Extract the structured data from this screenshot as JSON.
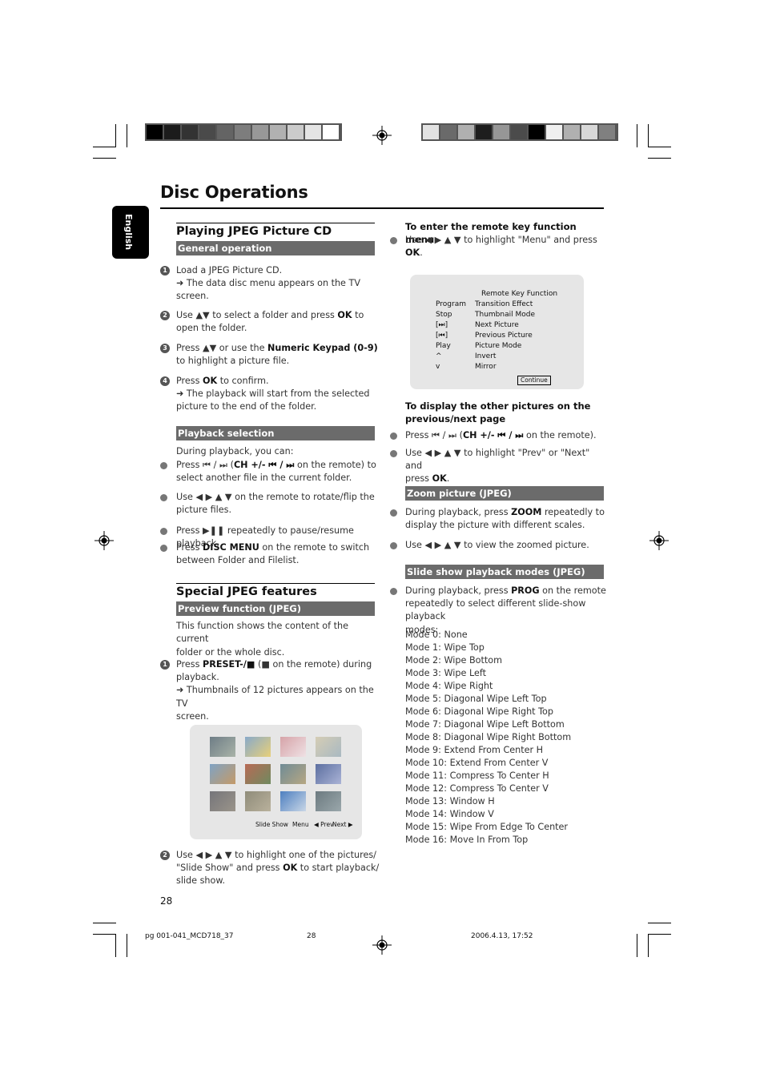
{
  "page": {
    "title": "Disc Operations",
    "language_tab": "English",
    "page_number": "28"
  },
  "print_marks": {
    "color_bar_left": [
      "#000000",
      "#1c1c1c",
      "#333333",
      "#4a4a4a",
      "#646464",
      "#7d7d7d",
      "#989898",
      "#b1b1b1",
      "#cbcbcb",
      "#e4e4e4",
      "#ffffff"
    ],
    "color_bar_right": [
      "#e2e2e2",
      "#6a6a6a",
      "#b0b0b0",
      "#1e1e1e",
      "#969696",
      "#4b4b4b",
      "#000000",
      "#f0f0f0",
      "#b0b0b0",
      "#d8d8d8",
      "#808080"
    ],
    "footer_file": "pg 001-041_MCD718_37",
    "footer_page": "28",
    "footer_date": "2006.4.13, 17:52"
  },
  "left": {
    "section1_title": "Playing JPEG Picture CD",
    "general_head": "General operation",
    "steps": [
      {
        "n": "1",
        "line1": "Load a JPEG Picture CD.",
        "line2": "➜ The data disc menu appears on the TV",
        "line3": "screen."
      },
      {
        "n": "2",
        "pre": "Use ▲▼  to select a folder and press ",
        "bold": "OK",
        "post": " to",
        "line2": "open the folder."
      },
      {
        "n": "3",
        "pre": "Press ▲▼  or use the ",
        "bold": "Numeric Keypad (0-9)",
        "line2": "to highlight a picture file."
      },
      {
        "n": "4",
        "pre": "Press ",
        "bold": "OK",
        "post": " to confirm.",
        "line2": "➜ The playback will start from the selected",
        "line3": "picture to the end of the folder."
      }
    ],
    "playback_head": "Playback selection",
    "playback_intro": "During playback, you can:",
    "playback_bullets": [
      {
        "pre": "Press  ⏮ / ⏭ (",
        "bold": "CH +/- ⏮ / ⏭",
        "post": " on the remote) to",
        "line2": "select another file in the current folder."
      },
      {
        "pre": "Use ◀ ▶ ▲ ▼ on the remote to rotate/flip the",
        "line2": "picture files."
      },
      {
        "pre": "Press  ▶❚❚ repeatedly to pause/resume playback."
      },
      {
        "pre": "Press ",
        "bold": "DISC MENU",
        "post": " on the remote to switch",
        "line2": "between Folder and Filelist."
      }
    ],
    "section2_title": "Special JPEG features",
    "preview_head": "Preview function (JPEG)",
    "preview_intro1": "This function shows the content of the current",
    "preview_intro2": "folder or the whole disc.",
    "preview_step1": {
      "n": "1",
      "pre": "Press ",
      "bold": "PRESET-/■",
      "post": " (■  on the remote) during",
      "line2": "playback.",
      "line3": "➜ Thumbnails of 12 pictures appears on the TV",
      "line4": "screen."
    },
    "preview_screen": {
      "thumbnails": [
        "jewelry-1",
        "jewelry-2",
        "jewelry-3",
        "jewelry-4",
        "jewelry-5",
        "jewelry-6",
        "jewelry-7",
        "jewelry-8",
        "jewelry-9",
        "jewelry-10",
        "jewelry-11",
        "jewelry-12"
      ],
      "slide_show": "Slide Show",
      "menu": "Menu",
      "prev": "◀ Prev",
      "next": "Next ▶"
    },
    "preview_step2": {
      "n": "2",
      "pre": "Use ◀ ▶ ▲ ▼ to highlight one of the pictures/",
      "line2a": "\"Slide Show\" and press ",
      "bold": "OK",
      "line2b": " to start playback/",
      "line3": "slide show."
    }
  },
  "right": {
    "remote_head": "To enter the remote key function menu",
    "remote_bullet": {
      "pre": "Use ◀ ▶ ▲ ▼ to highlight \"Menu\" and press",
      "bold": "OK",
      "post": "."
    },
    "remote_screen": {
      "title": "Remote Key Function",
      "rows": [
        {
          "key": "Program",
          "func": "Transition Effect"
        },
        {
          "key": "Stop",
          "func": "Thumbnail Mode"
        },
        {
          "key": "[⏭]",
          "func": "Next Picture"
        },
        {
          "key": "[⏮]",
          "func": "Previous Picture"
        },
        {
          "key": "Play",
          "func": "Picture Mode"
        },
        {
          "key": "^",
          "func": "Invert"
        },
        {
          "key": "v",
          "func": "Mirror"
        }
      ],
      "continue": "Continue"
    },
    "page_head1": "To display the other pictures on the",
    "page_head2": "previous/next page",
    "page_bullets": [
      {
        "pre": "Press  ⏮ / ⏭ (",
        "bold": "CH +/- ⏮ / ⏭",
        "post": " on the remote)."
      },
      {
        "pre": "Use ◀ ▶ ▲ ▼ to highlight \"Prev\" or \"Next\" and",
        "line2a": "press ",
        "bold": "OK",
        "line2b": "."
      }
    ],
    "zoom_head": "Zoom picture (JPEG)",
    "zoom_bullets": [
      {
        "pre": "During playback, press ",
        "bold": "ZOOM",
        "post": " repeatedly to",
        "line2": "display the picture with different scales."
      },
      {
        "pre": "Use ◀ ▶ ▲ ▼ to view the zoomed picture."
      }
    ],
    "slide_head": "Slide show playback modes (JPEG)",
    "slide_bullet": {
      "pre": "During playback, press ",
      "bold": "PROG",
      "post": " on the remote",
      "line2": "repeatedly to select different slide-show playback",
      "line3": "modes:"
    },
    "modes": [
      "Mode 0: None",
      "Mode 1: Wipe Top",
      "Mode 2: Wipe Bottom",
      "Mode 3: Wipe Left",
      "Mode 4: Wipe Right",
      "Mode 5: Diagonal Wipe Left Top",
      "Mode 6: Diagonal Wipe Right Top",
      "Mode 7: Diagonal Wipe Left Bottom",
      "Mode 8: Diagonal Wipe Right Bottom",
      "Mode 9: Extend From Center H",
      "Mode 10: Extend From Center V",
      "Mode 11: Compress To Center H",
      "Mode 12: Compress To Center V",
      "Mode 13: Window H",
      "Mode 14: Window V",
      "Mode 15: Wipe From Edge To Center",
      "Mode 16: Move In From Top"
    ]
  }
}
